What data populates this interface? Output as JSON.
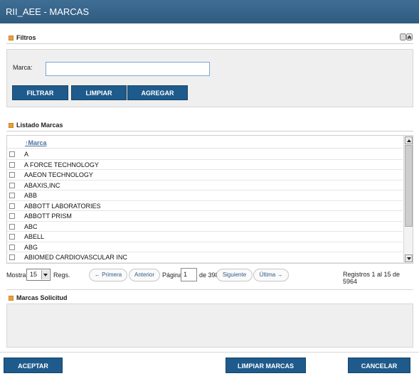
{
  "window": {
    "title": "RII_AEE - MARCAS"
  },
  "filtros": {
    "title": "Filtros",
    "marca_label": "Marca:",
    "marca_value": "",
    "buttons": {
      "filtrar": "FILTRAR",
      "limpiar": "LIMPIAR",
      "agregar": "AGREGAR"
    }
  },
  "listado": {
    "title": "Listado Marcas",
    "column_header": "Marca",
    "rows": [
      "A",
      "A FORCE TECHNOLOGY",
      "AAEON TECHNOLOGY",
      "ABAXIS,INC",
      "ABB",
      "ABBOTT LABORATORIES",
      "ABBOTT PRISM",
      "ABC",
      "ABELL",
      "ABG",
      "ABIOMED CARDIOVASCULAR INC"
    ]
  },
  "pager": {
    "mostrar_label": "Mostrar",
    "page_size": "15",
    "regs_label": "Regs.",
    "primera": "← Primera",
    "anterior": "Anterior",
    "pagina_label": "Página",
    "current_page": "1",
    "of_label": "de 398",
    "siguiente": "Siguiente",
    "ultima": "Última →",
    "registros": "Registros 1 al 15 de 5964"
  },
  "solicitud": {
    "title": "Marcas Solicitud"
  },
  "footer": {
    "aceptar": "ACEPTAR",
    "limpiar_marcas": "LIMPIAR MARCAS",
    "cancelar": "CANCELAR"
  },
  "colors": {
    "primary": "#1e5a8c",
    "titlebar": "#3a678d",
    "panel": "#efefef",
    "link": "#2f5b8a"
  }
}
